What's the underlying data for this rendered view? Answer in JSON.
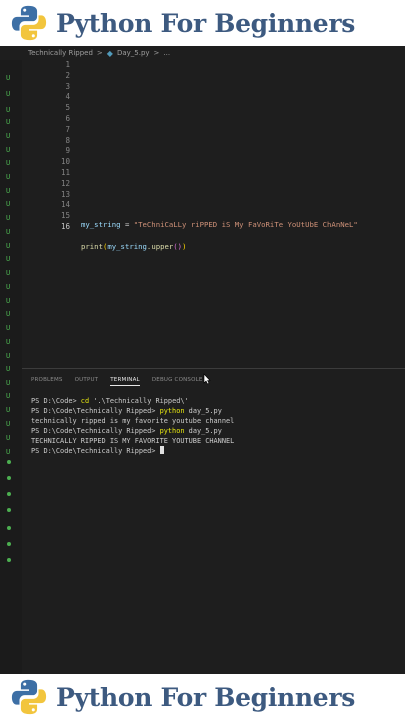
{
  "banner": {
    "title": "Python For Beginners"
  },
  "breadcrumb": {
    "folder": "Technically Ripped",
    "sep1": ">",
    "file": "Day_5.py",
    "sep2": ">",
    "more": "..."
  },
  "editor": {
    "line_numbers": [
      "1",
      "2",
      "3",
      "4",
      "5",
      "6",
      "7",
      "8",
      "9",
      "10",
      "11",
      "12",
      "13",
      "14",
      "15",
      "16"
    ],
    "line14": {
      "var": "my_string",
      "op": " = ",
      "str": "\"TeChniCaLLy riPPED iS My FaVoRiTe YoUtUbE ChAnNeL\""
    },
    "line16": {
      "fn": "print",
      "open": "(",
      "var": "my_string",
      "method": ".upper",
      "call": "()",
      "close": ")"
    }
  },
  "panel": {
    "tabs": [
      "PROBLEMS",
      "OUTPUT",
      "TERMINAL",
      "DEBUG CONSOLE"
    ],
    "active_tab": "TERMINAL"
  },
  "terminal": {
    "l1_prompt": "PS D:\\Code> ",
    "l1_cmd": "cd",
    "l1_arg": " '.\\Technically Ripped\\'",
    "l2_prompt": "PS D:\\Code\\Technically Ripped> ",
    "l2_cmd": "python",
    "l2_arg": " day_5.py",
    "l3": "technically ripped is my favorite youtube channel",
    "l4_prompt": "PS D:\\Code\\Technically Ripped> ",
    "l4_cmd": "python",
    "l4_arg": " day_5.py",
    "l5": "TECHNICALLY RIPPED IS MY FAVORITE YOUTUBE CHANNEL",
    "l6_prompt": "PS D:\\Code\\Technically Ripped> "
  },
  "gutter_markers": [
    "U",
    "U",
    "U",
    "U",
    "U",
    "U",
    "U",
    "U",
    "U",
    "U",
    "U",
    "U",
    "U",
    "U",
    "U",
    "U",
    "U",
    "U",
    "U",
    "U",
    "U",
    "U",
    "U",
    "U",
    "U",
    "U",
    "U",
    "U"
  ],
  "colors": {
    "banner_text": "#3d5a80",
    "editor_bg": "#1e1e1e",
    "git_untracked": "#4caf50"
  }
}
